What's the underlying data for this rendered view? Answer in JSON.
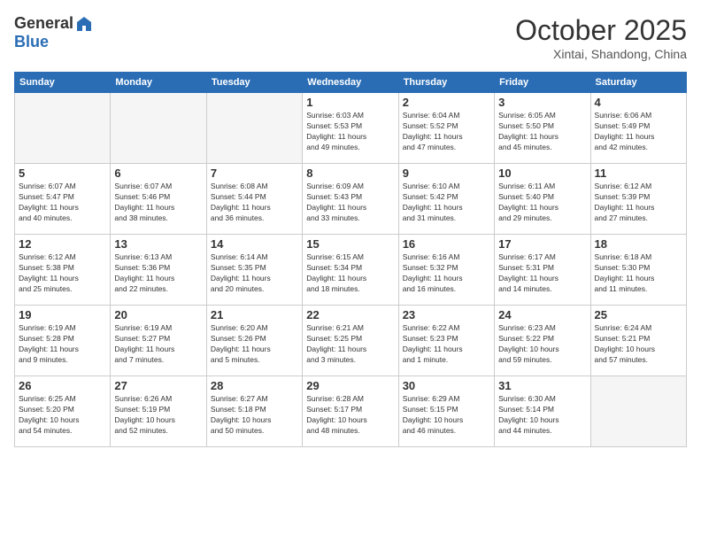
{
  "header": {
    "logo": {
      "general": "General",
      "blue": "Blue"
    },
    "title": "October 2025",
    "subtitle": "Xintai, Shandong, China"
  },
  "weekdays": [
    "Sunday",
    "Monday",
    "Tuesday",
    "Wednesday",
    "Thursday",
    "Friday",
    "Saturday"
  ],
  "weeks": [
    [
      {
        "day": "",
        "info": ""
      },
      {
        "day": "",
        "info": ""
      },
      {
        "day": "",
        "info": ""
      },
      {
        "day": "1",
        "info": "Sunrise: 6:03 AM\nSunset: 5:53 PM\nDaylight: 11 hours\nand 49 minutes."
      },
      {
        "day": "2",
        "info": "Sunrise: 6:04 AM\nSunset: 5:52 PM\nDaylight: 11 hours\nand 47 minutes."
      },
      {
        "day": "3",
        "info": "Sunrise: 6:05 AM\nSunset: 5:50 PM\nDaylight: 11 hours\nand 45 minutes."
      },
      {
        "day": "4",
        "info": "Sunrise: 6:06 AM\nSunset: 5:49 PM\nDaylight: 11 hours\nand 42 minutes."
      }
    ],
    [
      {
        "day": "5",
        "info": "Sunrise: 6:07 AM\nSunset: 5:47 PM\nDaylight: 11 hours\nand 40 minutes."
      },
      {
        "day": "6",
        "info": "Sunrise: 6:07 AM\nSunset: 5:46 PM\nDaylight: 11 hours\nand 38 minutes."
      },
      {
        "day": "7",
        "info": "Sunrise: 6:08 AM\nSunset: 5:44 PM\nDaylight: 11 hours\nand 36 minutes."
      },
      {
        "day": "8",
        "info": "Sunrise: 6:09 AM\nSunset: 5:43 PM\nDaylight: 11 hours\nand 33 minutes."
      },
      {
        "day": "9",
        "info": "Sunrise: 6:10 AM\nSunset: 5:42 PM\nDaylight: 11 hours\nand 31 minutes."
      },
      {
        "day": "10",
        "info": "Sunrise: 6:11 AM\nSunset: 5:40 PM\nDaylight: 11 hours\nand 29 minutes."
      },
      {
        "day": "11",
        "info": "Sunrise: 6:12 AM\nSunset: 5:39 PM\nDaylight: 11 hours\nand 27 minutes."
      }
    ],
    [
      {
        "day": "12",
        "info": "Sunrise: 6:12 AM\nSunset: 5:38 PM\nDaylight: 11 hours\nand 25 minutes."
      },
      {
        "day": "13",
        "info": "Sunrise: 6:13 AM\nSunset: 5:36 PM\nDaylight: 11 hours\nand 22 minutes."
      },
      {
        "day": "14",
        "info": "Sunrise: 6:14 AM\nSunset: 5:35 PM\nDaylight: 11 hours\nand 20 minutes."
      },
      {
        "day": "15",
        "info": "Sunrise: 6:15 AM\nSunset: 5:34 PM\nDaylight: 11 hours\nand 18 minutes."
      },
      {
        "day": "16",
        "info": "Sunrise: 6:16 AM\nSunset: 5:32 PM\nDaylight: 11 hours\nand 16 minutes."
      },
      {
        "day": "17",
        "info": "Sunrise: 6:17 AM\nSunset: 5:31 PM\nDaylight: 11 hours\nand 14 minutes."
      },
      {
        "day": "18",
        "info": "Sunrise: 6:18 AM\nSunset: 5:30 PM\nDaylight: 11 hours\nand 11 minutes."
      }
    ],
    [
      {
        "day": "19",
        "info": "Sunrise: 6:19 AM\nSunset: 5:28 PM\nDaylight: 11 hours\nand 9 minutes."
      },
      {
        "day": "20",
        "info": "Sunrise: 6:19 AM\nSunset: 5:27 PM\nDaylight: 11 hours\nand 7 minutes."
      },
      {
        "day": "21",
        "info": "Sunrise: 6:20 AM\nSunset: 5:26 PM\nDaylight: 11 hours\nand 5 minutes."
      },
      {
        "day": "22",
        "info": "Sunrise: 6:21 AM\nSunset: 5:25 PM\nDaylight: 11 hours\nand 3 minutes."
      },
      {
        "day": "23",
        "info": "Sunrise: 6:22 AM\nSunset: 5:23 PM\nDaylight: 11 hours\nand 1 minute."
      },
      {
        "day": "24",
        "info": "Sunrise: 6:23 AM\nSunset: 5:22 PM\nDaylight: 10 hours\nand 59 minutes."
      },
      {
        "day": "25",
        "info": "Sunrise: 6:24 AM\nSunset: 5:21 PM\nDaylight: 10 hours\nand 57 minutes."
      }
    ],
    [
      {
        "day": "26",
        "info": "Sunrise: 6:25 AM\nSunset: 5:20 PM\nDaylight: 10 hours\nand 54 minutes."
      },
      {
        "day": "27",
        "info": "Sunrise: 6:26 AM\nSunset: 5:19 PM\nDaylight: 10 hours\nand 52 minutes."
      },
      {
        "day": "28",
        "info": "Sunrise: 6:27 AM\nSunset: 5:18 PM\nDaylight: 10 hours\nand 50 minutes."
      },
      {
        "day": "29",
        "info": "Sunrise: 6:28 AM\nSunset: 5:17 PM\nDaylight: 10 hours\nand 48 minutes."
      },
      {
        "day": "30",
        "info": "Sunrise: 6:29 AM\nSunset: 5:15 PM\nDaylight: 10 hours\nand 46 minutes."
      },
      {
        "day": "31",
        "info": "Sunrise: 6:30 AM\nSunset: 5:14 PM\nDaylight: 10 hours\nand 44 minutes."
      },
      {
        "day": "",
        "info": ""
      }
    ]
  ]
}
